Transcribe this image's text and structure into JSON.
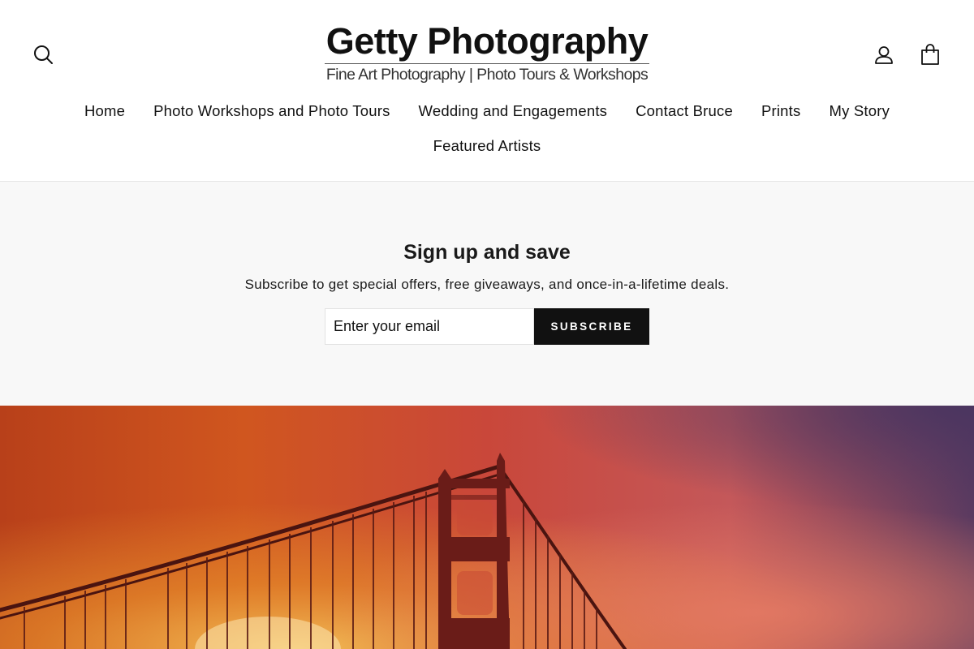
{
  "header": {
    "logo": {
      "title": "Getty Photography",
      "subtitle": "Fine Art Photography | Photo Tours & Workshops"
    },
    "icons": {
      "search": "search-icon",
      "account": "user-icon",
      "cart": "cart-icon"
    },
    "nav": {
      "items": [
        {
          "label": "Home"
        },
        {
          "label": "Photo Workshops and Photo Tours"
        },
        {
          "label": "Wedding and Engagements"
        },
        {
          "label": "Contact Bruce"
        },
        {
          "label": "Prints"
        },
        {
          "label": "My Story"
        },
        {
          "label": "Featured Artists"
        }
      ]
    }
  },
  "newsletter": {
    "title": "Sign up and save",
    "subtitle": "Subscribe to get special offers, free giveaways, and once-in-a-lifetime deals.",
    "email_placeholder": "Enter your email",
    "subscribe_label": "SUBSCRIBE"
  },
  "hero": {
    "image": "golden-gate-bridge-sunset-photo"
  },
  "colors": {
    "text": "#111111",
    "button_bg": "#111111",
    "button_text": "#ffffff",
    "newsletter_bg": "#f8f8f8",
    "divider": "#e6e6e6"
  }
}
